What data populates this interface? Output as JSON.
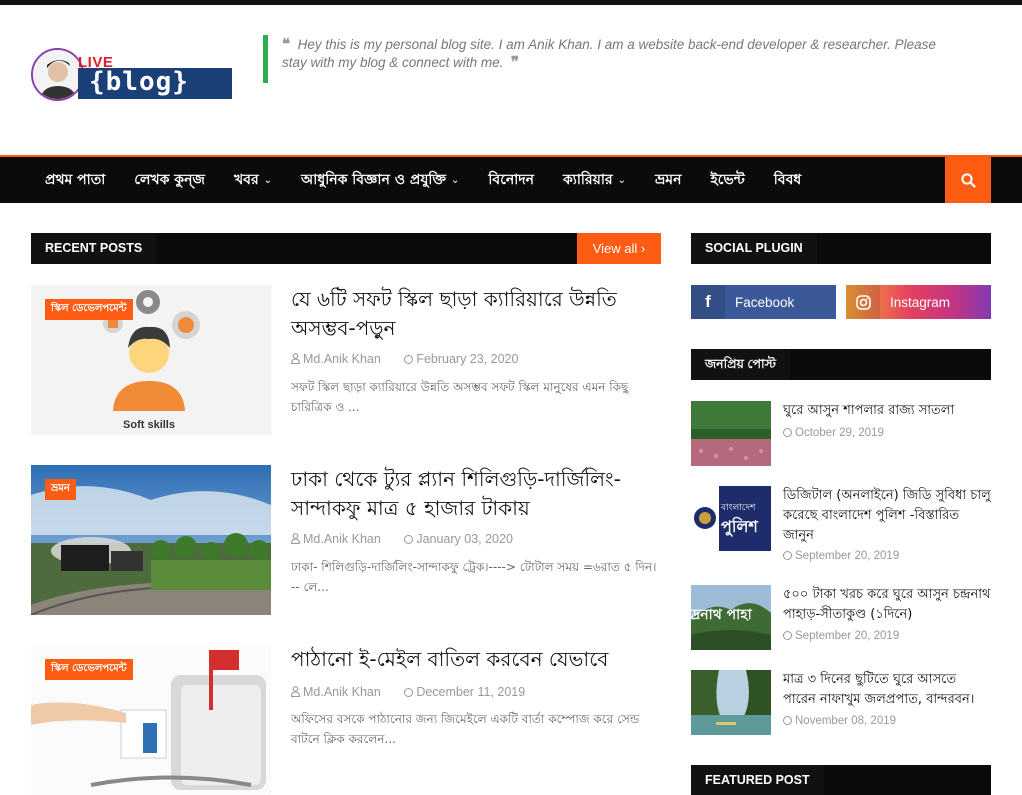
{
  "header": {
    "logo": {
      "live": "LIVE",
      "word": "{blog}"
    },
    "quote": "Hey this is my personal blog site. I am Anik Khan. I am a website back-end developer & researcher. Please stay with my blog & connect with me."
  },
  "nav": {
    "items": [
      {
        "label": "প্রথম পাতা",
        "dropdown": false
      },
      {
        "label": "লেখক কুন্জ",
        "dropdown": false
      },
      {
        "label": "খবর",
        "dropdown": true
      },
      {
        "label": "আধুনিক বিজ্ঞান ও প্রযুক্তি",
        "dropdown": true
      },
      {
        "label": "বিনোদন",
        "dropdown": false
      },
      {
        "label": "ক্যারিয়ার",
        "dropdown": true
      },
      {
        "label": "ভ্রমন",
        "dropdown": false
      },
      {
        "label": "ইভেন্ট",
        "dropdown": false
      },
      {
        "label": "বিবধ",
        "dropdown": false
      }
    ],
    "search_icon": "search-icon"
  },
  "recent": {
    "heading": "RECENT POSTS",
    "view_all": "View all",
    "posts": [
      {
        "badge": "স্কিল ডেভেলপমেন্ট",
        "thumb_caption": "Soft skills",
        "title": "যে ৬টি সফট স্কিল ছাড়া ক্যারিয়ারে উন্নতি অসম্ভব-পড়ুন",
        "author": "Md.Anik Khan",
        "date": "February 23, 2020",
        "excerpt": "সফট স্কিল ছাড়া ক্যারিয়ারে উন্নতি অসম্ভব সফট স্কিল মানুষের এমন কিছু চারিত্রিক ও ..."
      },
      {
        "badge": "ভ্রমন",
        "title": "ঢাকা থেকে ট্যুর প্ল্যান শিলিগুড়ি-দার্জিলিং-সান্দাকফু মাত্র ৫ হাজার টাকায়",
        "author": "Md.Anik Khan",
        "date": "January 03, 2020",
        "excerpt": "ঢাকা- শিলিগুড়ি-দার্জিলিং-সান্দাকফু ট্রেক।----> টোটাল সময় =৬রাত ৫ দিন। -- লে..."
      },
      {
        "badge": "স্কিল ডেভেলপমেন্ট",
        "title": "পাঠানো ই-মেইল বাতিল করবেন যেভাবে",
        "author": "Md.Anik Khan",
        "date": "December 11, 2019",
        "excerpt": "অফিসের বসকে পাঠানোর জন্য জিমেইলে একটি বার্তা কম্পোজ করে সেন্ড বাটনে ক্লিক করলেন..."
      }
    ]
  },
  "sidebar": {
    "social_heading": "SOCIAL PLUGIN",
    "facebook": "Facebook",
    "instagram": "Instagram",
    "popular_heading": "জনপ্রিয় পোস্ট",
    "popular": [
      {
        "title": "ঘুরে আসুন শাপলার রাজ্য সাতলা",
        "date": "October 29, 2019"
      },
      {
        "title": "ডিজিটাল (অনলাইনে) জিডি সুবিধা চালু করেছে বাংলাদেশ পুলিশ -বিস্তারিত জানুন",
        "date": "September 20, 2019",
        "thumb_text": [
          "বাংলাদেশ",
          "পুলিশ"
        ]
      },
      {
        "title": "৫০০ টাকা খরচ করে ঘুরে আসুন চন্দ্রনাথ পাহাড়-সীতাকুণ্ড (১দিনে)",
        "date": "September 20, 2019",
        "thumb_text": "দ্রনাথ পাহা"
      },
      {
        "title": "মাত্র ৩ দিনের ছুটিতে ঘুরে আসতে পারেন নাফাখুম জলপ্রপাত, বান্দরবন।",
        "date": "November 08, 2019"
      }
    ],
    "featured_heading": "FEATURED POST"
  },
  "colors": {
    "accent": "#fd5c12",
    "dark": "#0b0b0b",
    "quote_border": "#2bae52",
    "facebook": "#3b5998"
  }
}
